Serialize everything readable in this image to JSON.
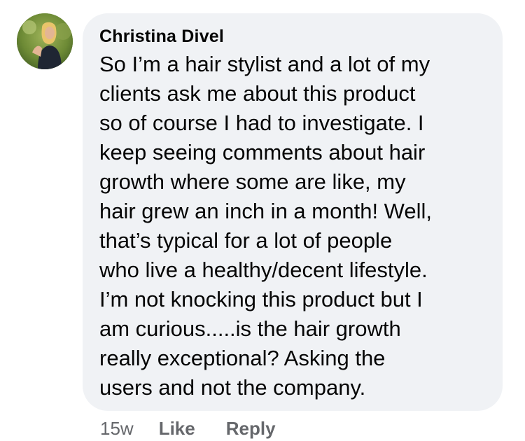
{
  "comment": {
    "author": "Christina Divel",
    "lines": [
      "So I’m a hair stylist and a lot of my",
      "clients ask me about this product",
      "so of course I had to investigate. I",
      "keep seeing comments about hair",
      "growth where some are like, my",
      "hair grew an inch in a month! Well,",
      "that’s typical for a lot of people",
      "who live a healthy/decent lifestyle.",
      "I’m not knocking this product but I",
      "am curious.....is the hair growth",
      "really exceptional? Asking the",
      "users and not the company."
    ],
    "timestamp": "15w",
    "like_label": "Like",
    "reply_label": "Reply"
  },
  "colors": {
    "bubble_background": "#f0f2f5",
    "text_primary": "#050505",
    "text_secondary": "#65676b"
  }
}
